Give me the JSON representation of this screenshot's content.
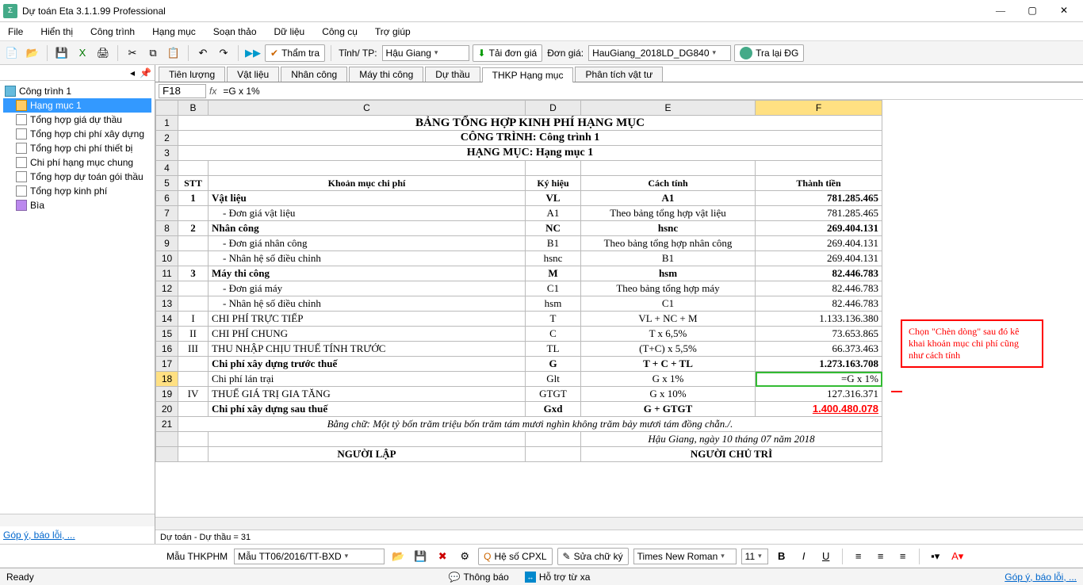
{
  "title": "Dự toán Eta 3.1.1.99 Professional",
  "menu": [
    "File",
    "Hiển thị",
    "Công trình",
    "Hạng mục",
    "Soạn thảo",
    "Dữ liệu",
    "Công cụ",
    "Trợ giúp"
  ],
  "toolbar": {
    "kiemtra": "Thẩm tra",
    "tinh_label": "Tỉnh/ TP:",
    "tinh_value": "Hậu Giang",
    "tai_dg": "Tải đơn giá",
    "dongia_label": "Đơn giá:",
    "dongia_value": "HauGiang_2018LD_DG840",
    "tra_lai": "Tra lại ĐG"
  },
  "sidebar": {
    "root": "Công trình 1",
    "items": [
      "Hạng mục 1",
      "Tổng hợp giá dự thầu",
      "Tổng hợp chi phí xây dựng",
      "Tổng hợp chi phí thiết bị",
      "Chi phí hạng mục chung",
      "Tổng hợp dự toán gói thầu",
      "Tổng hợp kinh phí",
      "Bìa"
    ]
  },
  "tabs": [
    "Tiên lượng",
    "Vật liệu",
    "Nhân công",
    "Máy thi công",
    "Dự thầu",
    "THKP Hạng mục",
    "Phân tích vật tư"
  ],
  "active_tab": "THKP Hạng mục",
  "cell_ref": {
    "name": "F18",
    "formula": "=G x 1%"
  },
  "headings": {
    "title": "BẢNG TỔNG HỢP KINH PHÍ HẠNG MỤC",
    "sub1": "CÔNG TRÌNH: Công trình 1",
    "sub2": "HẠNG MỤC: Hạng mục 1"
  },
  "col_headers": [
    "B",
    "C",
    "D",
    "E",
    "F"
  ],
  "table_header": [
    "STT",
    "Khoản mục chi phí",
    "Ký hiệu",
    "Cách tính",
    "Thành tiền"
  ],
  "rows": [
    {
      "n": "6",
      "stt": "1",
      "name": "Vật liệu",
      "sym": "VL",
      "calc": "A1",
      "val": "781.285.465",
      "bold": true
    },
    {
      "n": "7",
      "stt": "",
      "name": "  - Đơn giá vật liệu",
      "sym": "A1",
      "calc": "Theo bảng tổng hợp vật liệu",
      "val": "781.285.465"
    },
    {
      "n": "8",
      "stt": "2",
      "name": "Nhân công",
      "sym": "NC",
      "calc": "hsnc",
      "val": "269.404.131",
      "bold": true
    },
    {
      "n": "9",
      "stt": "",
      "name": "  - Đơn giá nhân công",
      "sym": "B1",
      "calc": "Theo bảng tổng hợp nhân công",
      "val": "269.404.131"
    },
    {
      "n": "10",
      "stt": "",
      "name": "  - Nhân hệ số điều chỉnh",
      "sym": "hsnc",
      "calc": "B1",
      "val": "269.404.131"
    },
    {
      "n": "11",
      "stt": "3",
      "name": "Máy thi công",
      "sym": "M",
      "calc": "hsm",
      "val": "82.446.783",
      "bold": true
    },
    {
      "n": "12",
      "stt": "",
      "name": "  - Đơn giá máy",
      "sym": "C1",
      "calc": "Theo bảng tổng hợp máy",
      "val": "82.446.783"
    },
    {
      "n": "13",
      "stt": "",
      "name": "  - Nhân hệ số điều chỉnh",
      "sym": "hsm",
      "calc": "C1",
      "val": "82.446.783"
    },
    {
      "n": "14",
      "stt": "I",
      "name": "CHI PHÍ TRỰC TIẾP",
      "sym": "T",
      "calc": "VL + NC + M",
      "val": "1.133.136.380"
    },
    {
      "n": "15",
      "stt": "II",
      "name": "CHI PHÍ CHUNG",
      "sym": "C",
      "calc": "T x 6,5%",
      "val": "73.653.865"
    },
    {
      "n": "16",
      "stt": "III",
      "name": "THU NHẬP CHỊU THUẾ TÍNH TRƯỚC",
      "sym": "TL",
      "calc": "(T+C) x 5,5%",
      "val": "66.373.463"
    },
    {
      "n": "17",
      "stt": "",
      "name": "Chi phí xây dựng trước thuế",
      "sym": "G",
      "calc": "T + C + TL",
      "val": "1.273.163.708",
      "bold": true
    },
    {
      "n": "18",
      "stt": "",
      "name": "Chi phí lán trại",
      "sym": "Glt",
      "calc": "G x 1%",
      "val": "=G x 1%",
      "red": true,
      "active": true
    },
    {
      "n": "19",
      "stt": "IV",
      "name": "THUẾ GIÁ TRỊ GIA TĂNG",
      "sym": "GTGT",
      "calc": "G x 10%",
      "val": "127.316.371"
    },
    {
      "n": "20",
      "stt": "",
      "name": "Chi phí xây dựng sau thuế",
      "sym": "Gxd",
      "calc": "G + GTGT",
      "val": "1.400.480.078",
      "bold": true,
      "finalred": true
    }
  ],
  "bangchu": "Bằng chữ: Một tỷ bốn trăm triệu bốn trăm tám mươi nghìn không trăm bảy mươi tám đồng chẵn./.",
  "footer": {
    "loc_date": "Hậu Giang, ngày 10 tháng 07 năm 2018",
    "left": "NGƯỜI LẬP",
    "right": "NGƯỜI CHỦ TRÌ"
  },
  "callout": "Chọn \"Chèn dòng\" sau đó kê khai khoản mục chi phí cũng như cách tính",
  "status_mid": "Dự toán - Dự thầu = 31",
  "bottom": {
    "mau_label": "Mẫu THKPHM",
    "mau_value": "Mẫu TT06/2016/TT-BXD",
    "hscpxl": "Hệ số CPXL",
    "sign": "Sửa chữ ký",
    "font": "Times New Roman",
    "size": "11"
  },
  "status_left": "Ready",
  "status_thongbao": "Thông báo",
  "status_hotro": "Hỗ trợ từ xa",
  "link_gopy": "Góp ý, báo lỗi, ..."
}
